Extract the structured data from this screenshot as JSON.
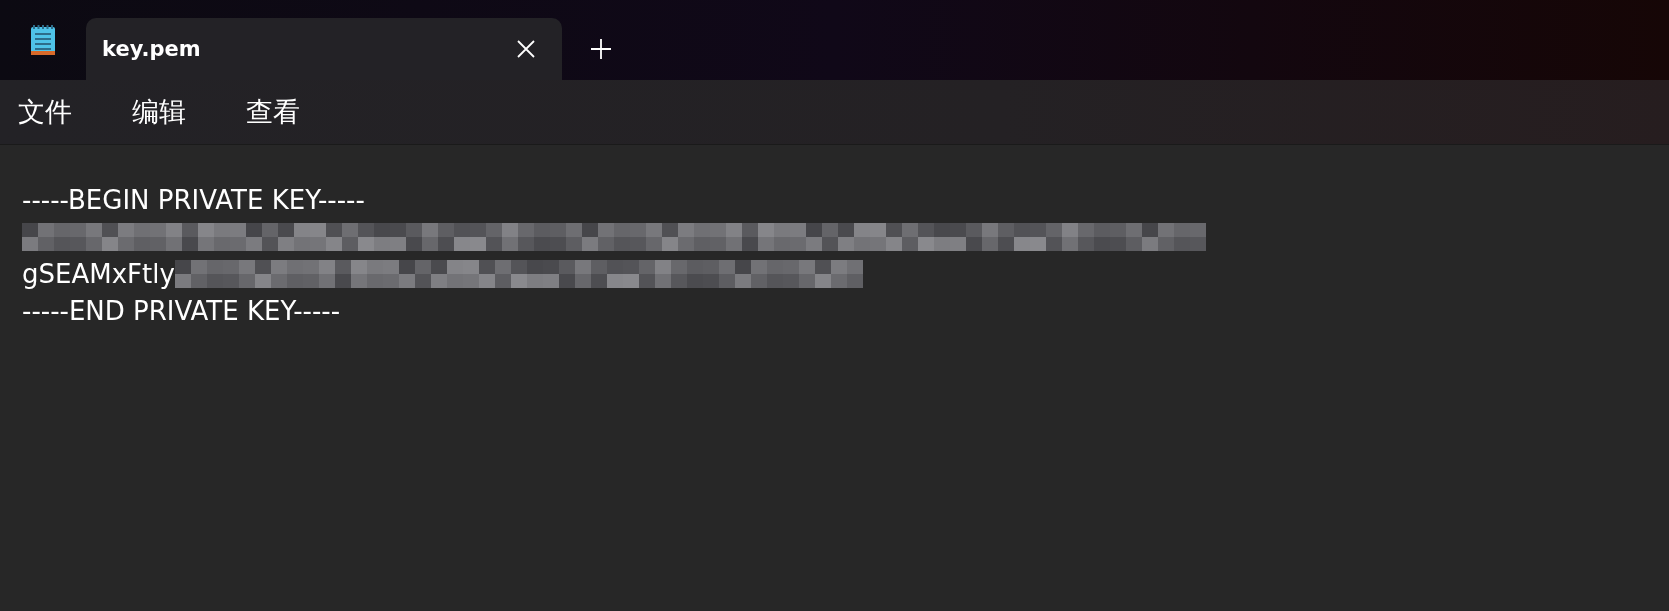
{
  "tabs": [
    {
      "title": "key.pem",
      "selected": true
    }
  ],
  "menu": [
    "文件",
    "编辑",
    "查看"
  ],
  "lines": [
    {
      "kind": "text",
      "text": "-----BEGIN PRIVATE KEY-----"
    },
    {
      "kind": "redacted"
    },
    {
      "kind": "redacted",
      "text": "gSEAMxFtly"
    },
    {
      "kind": "text",
      "text": "-----END PRIVATE KEY-----"
    }
  ]
}
